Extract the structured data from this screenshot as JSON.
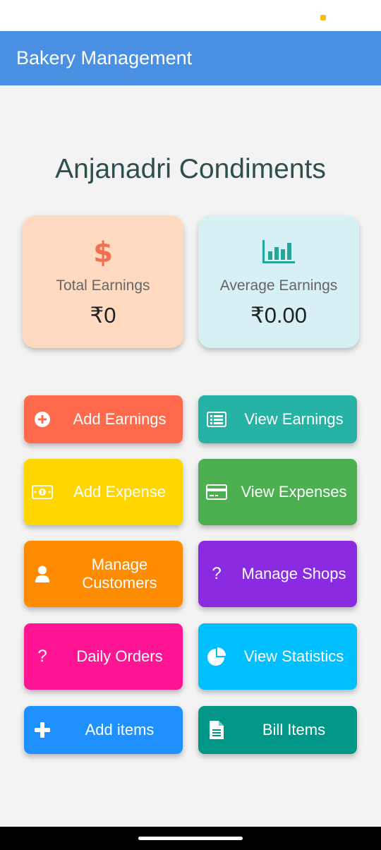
{
  "app_bar": {
    "title": "Bakery Management"
  },
  "shop": {
    "name": "Anjanadri Condiments"
  },
  "cards": {
    "total": {
      "label": "Total Earnings",
      "value": "₹0",
      "icon": "dollar-icon",
      "icon_color": "#f26f4f"
    },
    "average": {
      "label": "Average Earnings",
      "value": "₹0.00",
      "icon": "bar-chart-icon",
      "icon_color": "#26a69a"
    }
  },
  "buttons": {
    "add_earnings": {
      "label": "Add Earnings",
      "icon": "plus-circle-icon",
      "color": "#ff6a4d"
    },
    "view_earnings": {
      "label": "View Earnings",
      "icon": "list-alt-icon",
      "color": "#26b3a6"
    },
    "add_expense": {
      "label": "Add Expense",
      "icon": "money-bill-icon",
      "color": "#ffd600"
    },
    "view_expenses": {
      "label": "View Expenses",
      "icon": "credit-card-icon",
      "color": "#4caf50"
    },
    "manage_customers": {
      "label": "Manage Customers",
      "icon": "user-icon",
      "color": "#ff8c00"
    },
    "manage_shops": {
      "label": "Manage Shops",
      "icon": "question-icon",
      "glyph": "?",
      "color": "#8a2be2"
    },
    "daily_orders": {
      "label": "Daily Orders",
      "icon": "question-icon",
      "glyph": "?",
      "color": "#ff1493"
    },
    "view_statistics": {
      "label": "View Statistics",
      "icon": "pie-chart-icon",
      "color": "#00bfff"
    },
    "add_items": {
      "label": "Add items",
      "icon": "plus-icon",
      "color": "#1e90ff"
    },
    "bill_items": {
      "label": "Bill Items",
      "icon": "file-icon",
      "color": "#009688"
    }
  }
}
